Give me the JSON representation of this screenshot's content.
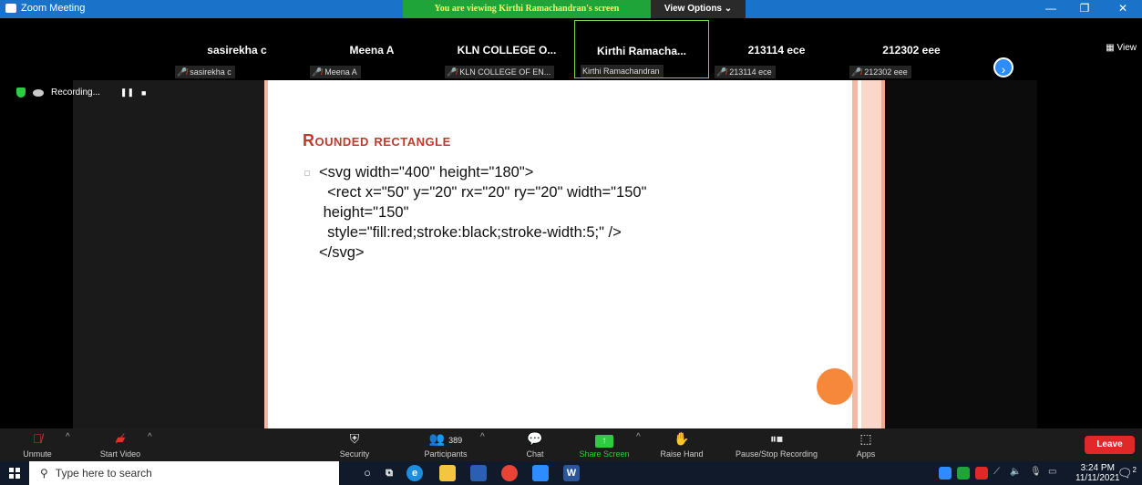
{
  "window": {
    "title": "Zoom Meeting",
    "viewing_banner": "You are viewing Kirthi Ramachandran's screen",
    "view_options": "View Options ⌄",
    "minimize": "—",
    "restore": "❐",
    "close": "✕"
  },
  "participants": [
    {
      "name": "sasirekha c",
      "label": "sasirekha c",
      "muted": true
    },
    {
      "name": "Meena A",
      "label": "Meena A",
      "muted": true
    },
    {
      "name": "KLN COLLEGE O...",
      "label": "KLN COLLEGE OF EN...",
      "muted": true
    },
    {
      "name": "Kirthi  Ramacha...",
      "label": "Kirthi Ramachandran",
      "muted": false
    },
    {
      "name": "213114 ece",
      "label": "213114 ece",
      "muted": true
    },
    {
      "name": "212302 eee",
      "label": "212302 eee",
      "muted": true
    }
  ],
  "strip": {
    "next_icon": "›",
    "view_label": "View"
  },
  "recording": {
    "label": "Recording...",
    "pause_glyph": "❚❚",
    "stop_glyph": "■"
  },
  "slide": {
    "title": "Rounded rectangle",
    "code": "<svg width=\"400\" height=\"180\">\n  <rect x=\"50\" y=\"20\" rx=\"20\" ry=\"20\" width=\"150\"\n height=\"150\"\n  style=\"fill:red;stroke:black;stroke-width:5;\" />\n</svg>"
  },
  "toolbar": {
    "unmute": "Unmute",
    "start_video": "Start Video",
    "security": "Security",
    "participants": "Participants",
    "participants_count": "389",
    "chat": "Chat",
    "share_screen": "Share Screen",
    "raise_hand": "Raise Hand",
    "pause_stop_recording": "Pause/Stop Recording",
    "apps": "Apps",
    "leave": "Leave"
  },
  "taskbar": {
    "search_placeholder": "Type here to search",
    "time": "3:24 PM",
    "date": "11/11/2021",
    "notification_count": "2"
  },
  "colors": {
    "zoom_blue": "#1a73c9",
    "viewing_green": "#1fa43a",
    "slide_title_red": "#c0392b",
    "leave_red": "#e02828",
    "share_green": "#2ecc40"
  }
}
